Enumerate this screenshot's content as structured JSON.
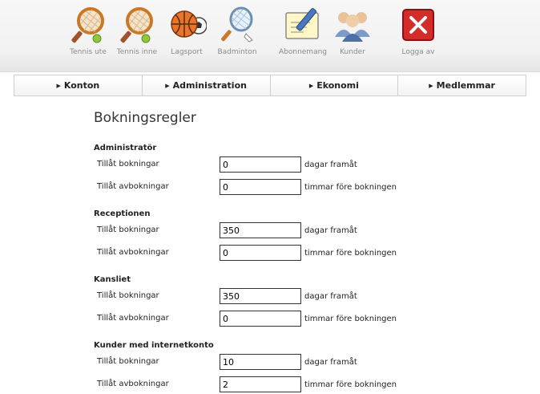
{
  "toolbar": {
    "items": [
      {
        "label": "Tennis ute",
        "icon": "tennis-racket-icon"
      },
      {
        "label": "Tennis inne",
        "icon": "tennis-racket-icon"
      },
      {
        "label": "Lagsport",
        "icon": "sports-balls-icon"
      },
      {
        "label": "Badminton",
        "icon": "badminton-racket-icon"
      },
      {
        "label": "Abonnemang",
        "icon": "subscription-pen-icon"
      },
      {
        "label": "Kunder",
        "icon": "customers-icon"
      },
      {
        "label": "Logga av",
        "icon": "logout-icon"
      }
    ]
  },
  "nav": {
    "items": [
      {
        "label": "Konton"
      },
      {
        "label": "Administration"
      },
      {
        "label": "Ekonomi"
      },
      {
        "label": "Medlemmar"
      }
    ]
  },
  "page": {
    "title": "Bokningsregler"
  },
  "sections": [
    {
      "title": "Administratör",
      "rows": [
        {
          "label": "Tillåt bokningar",
          "value": "0",
          "suffix": "dagar framåt"
        },
        {
          "label": "Tillåt avbokningar",
          "value": "0",
          "suffix": "timmar före bokningen"
        }
      ]
    },
    {
      "title": "Receptionen",
      "rows": [
        {
          "label": "Tillåt bokningar",
          "value": "350",
          "suffix": "dagar framåt"
        },
        {
          "label": "Tillåt avbokningar",
          "value": "0",
          "suffix": "timmar före bokningen"
        }
      ]
    },
    {
      "title": "Kansliet",
      "rows": [
        {
          "label": "Tillåt bokningar",
          "value": "350",
          "suffix": "dagar framåt"
        },
        {
          "label": "Tillåt avbokningar",
          "value": "0",
          "suffix": "timmar före bokningen"
        }
      ]
    },
    {
      "title": "Kunder med internetkonto",
      "rows": [
        {
          "label": "Tillåt bokningar",
          "value": "10",
          "suffix": "dagar framåt"
        },
        {
          "label": "Tillåt avbokningar",
          "value": "2",
          "suffix": "timmar före bokningen"
        }
      ]
    }
  ]
}
